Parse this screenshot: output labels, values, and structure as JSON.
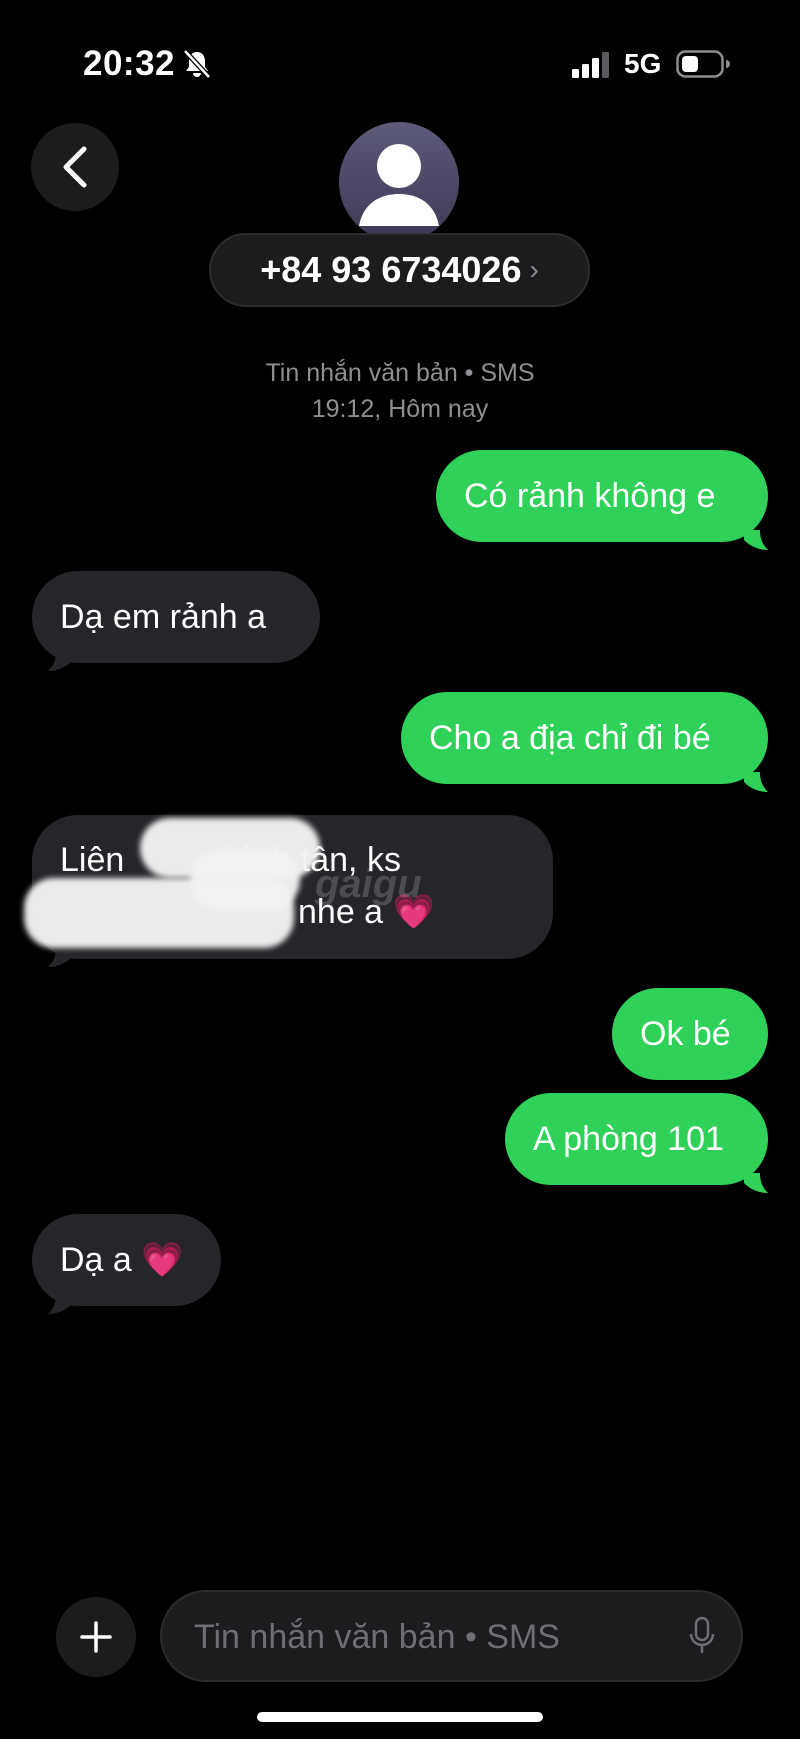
{
  "status": {
    "time": "20:32",
    "network": "5G"
  },
  "header": {
    "contact_number": "+84 93 6734026",
    "chevron": "›"
  },
  "info": {
    "type": "Tin nhắn văn bản • SMS",
    "time": "19:12, Hôm nay"
  },
  "messages": [
    {
      "from": "me",
      "text": "Có rảnh không e"
    },
    {
      "from": "them",
      "text": "Dạ em rảnh a"
    },
    {
      "from": "me",
      "text": "Cho a địa chỉ đi bé"
    },
    {
      "from": "them",
      "line1": "Liên",
      "line1_visible": ", bình tân, ks",
      "line2": "nhe a 💗"
    },
    {
      "from": "me",
      "text": "Ok bé"
    },
    {
      "from": "me",
      "text": "A phòng 101"
    },
    {
      "from": "them",
      "text": "Dạ a 💗"
    }
  ],
  "watermark": "gaigu",
  "composer": {
    "placeholder": "Tin nhắn văn bản • SMS"
  },
  "icons": [
    "bell-slash-icon",
    "signal-icon",
    "battery-icon",
    "back-chevron-icon",
    "person-icon",
    "plus-icon",
    "mic-icon"
  ],
  "colors": {
    "sent": "#30d158",
    "received": "#26252a",
    "background": "#000000"
  }
}
